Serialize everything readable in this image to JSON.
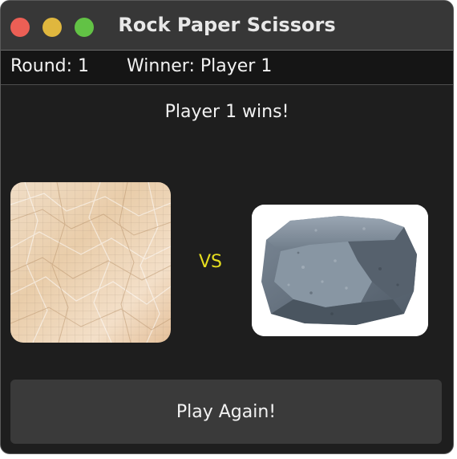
{
  "window": {
    "title": "Rock Paper Scissors",
    "controls": [
      "close-icon",
      "minimize-icon",
      "maximize-icon"
    ]
  },
  "status": {
    "round": "Round: 1",
    "winner": "Winner: Player 1"
  },
  "result": "Player 1 wins!",
  "versus": "VS",
  "player1_choice": {
    "icon": "paper-icon"
  },
  "player2_choice": {
    "icon": "rock-icon"
  },
  "play_again_label": "Play Again!",
  "colors": {
    "window_background": "#1e1e1e",
    "titlebar": "#373737",
    "close": "#ec5f55",
    "minimize": "#e0b73e",
    "maximize": "#62c245",
    "versus_text": "#e6de1f",
    "button": "#3a3a3a",
    "text": "#f2f2f2"
  }
}
